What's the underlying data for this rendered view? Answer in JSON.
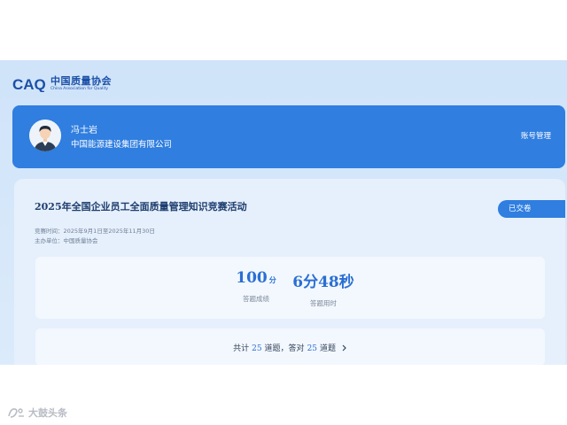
{
  "brand": {
    "logo_mark_text": "CAQ",
    "name_cn": "中国质量协会",
    "name_en": "China Association for Quality",
    "primary_color": "#2f7ee0"
  },
  "user": {
    "name": "冯士岩",
    "organization": "中国能源建设集团有限公司",
    "account_link": "账号管理",
    "avatar_icon": "user-avatar-icon"
  },
  "contest": {
    "title": "2025年全国企业员工全面质量管理知识竞赛活动",
    "status": "已交卷",
    "time_line": "竞赛时间：2025年9月1日至2025年11月30日",
    "organizer_line": "主办单位：中国质量协会"
  },
  "result": {
    "score_value": "100",
    "score_unit": "分",
    "score_label": "答题成绩",
    "time_min": "6",
    "time_min_unit": "分",
    "time_sec": "48",
    "time_sec_unit": "秒",
    "time_label": "答题用时"
  },
  "summary": {
    "prefix": "共计",
    "total": "25",
    "middle": "道题，答对",
    "correct": "25",
    "suffix": "道题",
    "chevron_icon": "chevron-right-icon"
  },
  "watermark": {
    "text": "大鼓头条"
  }
}
